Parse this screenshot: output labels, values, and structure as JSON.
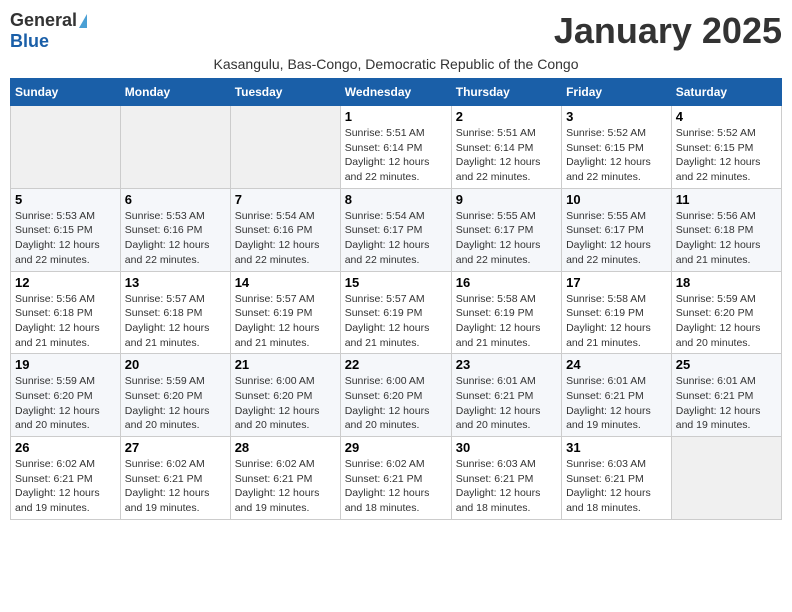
{
  "logo": {
    "general": "General",
    "blue": "Blue"
  },
  "title": "January 2025",
  "subtitle": "Kasangulu, Bas-Congo, Democratic Republic of the Congo",
  "days_of_week": [
    "Sunday",
    "Monday",
    "Tuesday",
    "Wednesday",
    "Thursday",
    "Friday",
    "Saturday"
  ],
  "weeks": [
    [
      {
        "day": "",
        "info": ""
      },
      {
        "day": "",
        "info": ""
      },
      {
        "day": "",
        "info": ""
      },
      {
        "day": "1",
        "info": "Sunrise: 5:51 AM\nSunset: 6:14 PM\nDaylight: 12 hours and 22 minutes."
      },
      {
        "day": "2",
        "info": "Sunrise: 5:51 AM\nSunset: 6:14 PM\nDaylight: 12 hours and 22 minutes."
      },
      {
        "day": "3",
        "info": "Sunrise: 5:52 AM\nSunset: 6:15 PM\nDaylight: 12 hours and 22 minutes."
      },
      {
        "day": "4",
        "info": "Sunrise: 5:52 AM\nSunset: 6:15 PM\nDaylight: 12 hours and 22 minutes."
      }
    ],
    [
      {
        "day": "5",
        "info": "Sunrise: 5:53 AM\nSunset: 6:15 PM\nDaylight: 12 hours and 22 minutes."
      },
      {
        "day": "6",
        "info": "Sunrise: 5:53 AM\nSunset: 6:16 PM\nDaylight: 12 hours and 22 minutes."
      },
      {
        "day": "7",
        "info": "Sunrise: 5:54 AM\nSunset: 6:16 PM\nDaylight: 12 hours and 22 minutes."
      },
      {
        "day": "8",
        "info": "Sunrise: 5:54 AM\nSunset: 6:17 PM\nDaylight: 12 hours and 22 minutes."
      },
      {
        "day": "9",
        "info": "Sunrise: 5:55 AM\nSunset: 6:17 PM\nDaylight: 12 hours and 22 minutes."
      },
      {
        "day": "10",
        "info": "Sunrise: 5:55 AM\nSunset: 6:17 PM\nDaylight: 12 hours and 22 minutes."
      },
      {
        "day": "11",
        "info": "Sunrise: 5:56 AM\nSunset: 6:18 PM\nDaylight: 12 hours and 21 minutes."
      }
    ],
    [
      {
        "day": "12",
        "info": "Sunrise: 5:56 AM\nSunset: 6:18 PM\nDaylight: 12 hours and 21 minutes."
      },
      {
        "day": "13",
        "info": "Sunrise: 5:57 AM\nSunset: 6:18 PM\nDaylight: 12 hours and 21 minutes."
      },
      {
        "day": "14",
        "info": "Sunrise: 5:57 AM\nSunset: 6:19 PM\nDaylight: 12 hours and 21 minutes."
      },
      {
        "day": "15",
        "info": "Sunrise: 5:57 AM\nSunset: 6:19 PM\nDaylight: 12 hours and 21 minutes."
      },
      {
        "day": "16",
        "info": "Sunrise: 5:58 AM\nSunset: 6:19 PM\nDaylight: 12 hours and 21 minutes."
      },
      {
        "day": "17",
        "info": "Sunrise: 5:58 AM\nSunset: 6:19 PM\nDaylight: 12 hours and 21 minutes."
      },
      {
        "day": "18",
        "info": "Sunrise: 5:59 AM\nSunset: 6:20 PM\nDaylight: 12 hours and 20 minutes."
      }
    ],
    [
      {
        "day": "19",
        "info": "Sunrise: 5:59 AM\nSunset: 6:20 PM\nDaylight: 12 hours and 20 minutes."
      },
      {
        "day": "20",
        "info": "Sunrise: 5:59 AM\nSunset: 6:20 PM\nDaylight: 12 hours and 20 minutes."
      },
      {
        "day": "21",
        "info": "Sunrise: 6:00 AM\nSunset: 6:20 PM\nDaylight: 12 hours and 20 minutes."
      },
      {
        "day": "22",
        "info": "Sunrise: 6:00 AM\nSunset: 6:20 PM\nDaylight: 12 hours and 20 minutes."
      },
      {
        "day": "23",
        "info": "Sunrise: 6:01 AM\nSunset: 6:21 PM\nDaylight: 12 hours and 20 minutes."
      },
      {
        "day": "24",
        "info": "Sunrise: 6:01 AM\nSunset: 6:21 PM\nDaylight: 12 hours and 19 minutes."
      },
      {
        "day": "25",
        "info": "Sunrise: 6:01 AM\nSunset: 6:21 PM\nDaylight: 12 hours and 19 minutes."
      }
    ],
    [
      {
        "day": "26",
        "info": "Sunrise: 6:02 AM\nSunset: 6:21 PM\nDaylight: 12 hours and 19 minutes."
      },
      {
        "day": "27",
        "info": "Sunrise: 6:02 AM\nSunset: 6:21 PM\nDaylight: 12 hours and 19 minutes."
      },
      {
        "day": "28",
        "info": "Sunrise: 6:02 AM\nSunset: 6:21 PM\nDaylight: 12 hours and 19 minutes."
      },
      {
        "day": "29",
        "info": "Sunrise: 6:02 AM\nSunset: 6:21 PM\nDaylight: 12 hours and 18 minutes."
      },
      {
        "day": "30",
        "info": "Sunrise: 6:03 AM\nSunset: 6:21 PM\nDaylight: 12 hours and 18 minutes."
      },
      {
        "day": "31",
        "info": "Sunrise: 6:03 AM\nSunset: 6:21 PM\nDaylight: 12 hours and 18 minutes."
      },
      {
        "day": "",
        "info": ""
      }
    ]
  ]
}
